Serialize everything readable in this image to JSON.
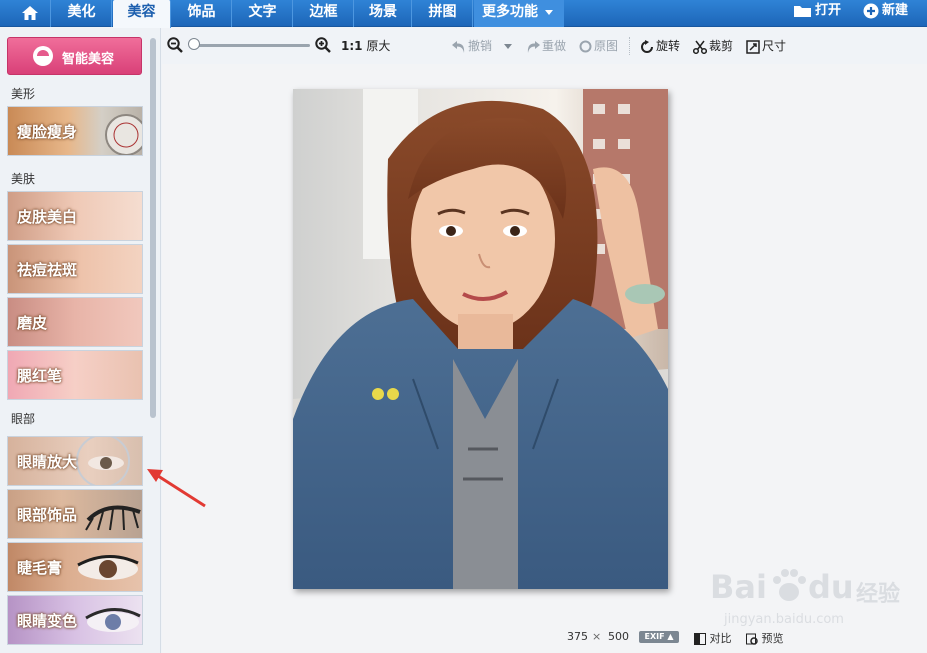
{
  "nav": {
    "tabs": [
      {
        "label": "美化"
      },
      {
        "label": "美容",
        "active": true
      },
      {
        "label": "饰品"
      },
      {
        "label": "文字"
      },
      {
        "label": "边框"
      },
      {
        "label": "场景"
      },
      {
        "label": "拼图"
      }
    ],
    "more_label": "更多功能",
    "open_label": "打开",
    "new_label": "新建"
  },
  "sidebar": {
    "smart_button_label": "智能美容",
    "sections": [
      {
        "title": "美形",
        "items": [
          {
            "label": "瘦脸瘦身"
          }
        ]
      },
      {
        "title": "美肤",
        "items": [
          {
            "label": "皮肤美白"
          },
          {
            "label": "祛痘祛斑"
          },
          {
            "label": "磨皮"
          },
          {
            "label": "腮红笔"
          }
        ]
      },
      {
        "title": "眼部",
        "items": [
          {
            "label": "眼睛放大"
          },
          {
            "label": "眼部饰品"
          },
          {
            "label": "睫毛膏"
          },
          {
            "label": "眼睛变色"
          }
        ]
      }
    ]
  },
  "toolbar": {
    "zoom_ratio": "1:1",
    "original_size": "原大",
    "undo": "撤销",
    "redo": "重做",
    "original": "原图",
    "rotate": "旋转",
    "crop": "裁剪",
    "size": "尺寸"
  },
  "status": {
    "width": "375",
    "times": "×",
    "height": "500",
    "exif": "EXIF",
    "compare": "对比",
    "preview": "预览"
  },
  "watermark": {
    "brand": "Bai",
    "brand2": "du",
    "cn": "经验",
    "url": "jingyan.baidu.com"
  },
  "colors": {
    "nav_blue": "#1d66b8",
    "active_tab": "#f4f8fc",
    "smart_pink": "#e04f83"
  }
}
